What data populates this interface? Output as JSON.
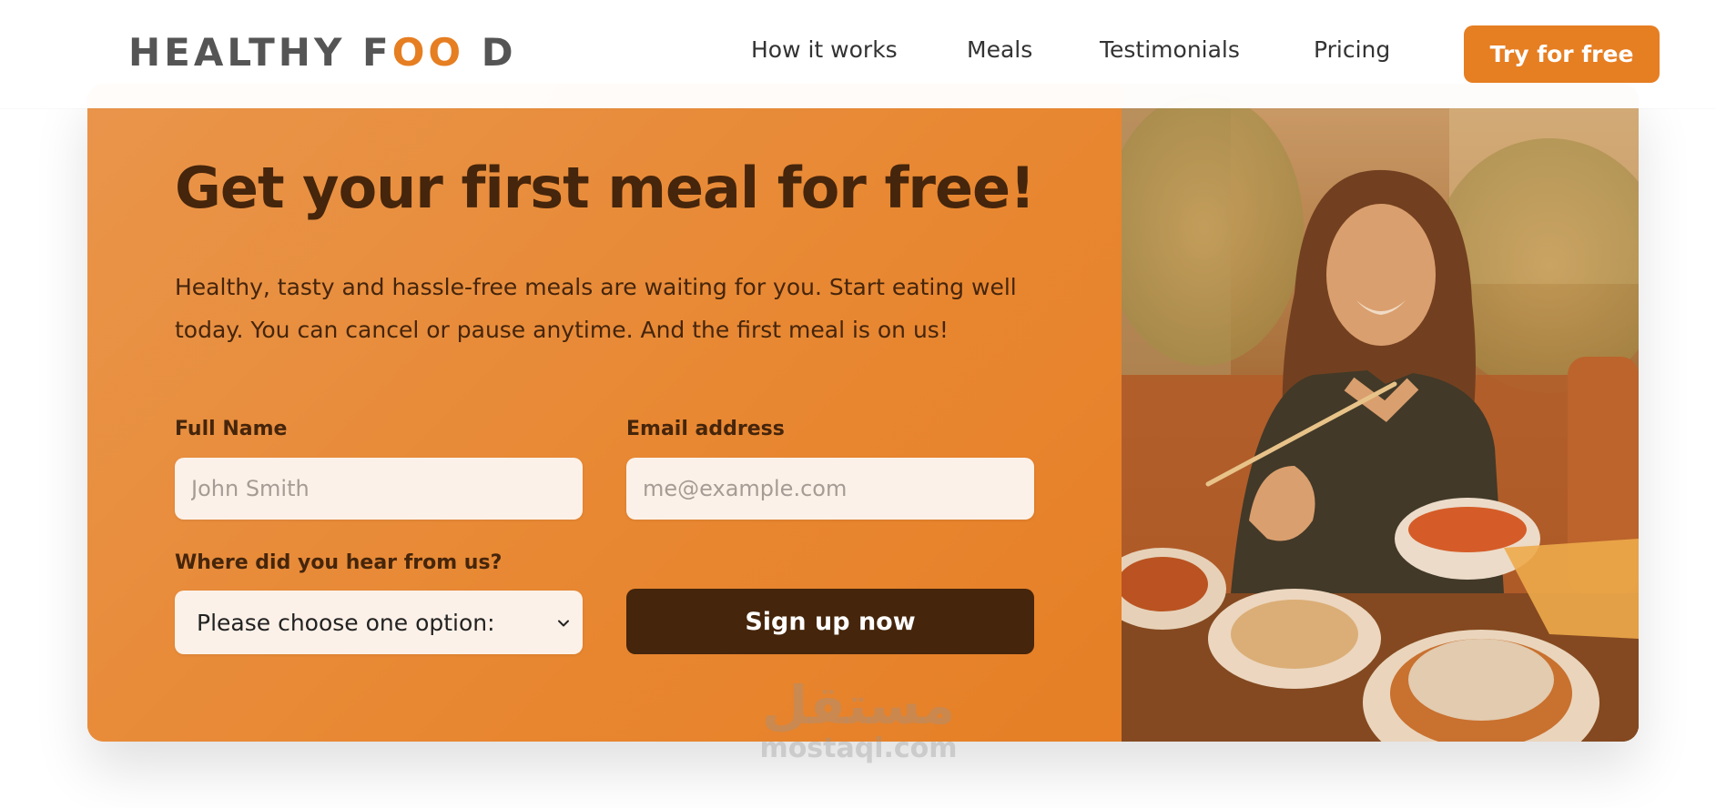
{
  "header": {
    "logo": {
      "part1": "HEALTHY F",
      "part2": "OO",
      "part3": " D"
    },
    "nav": [
      "How it works",
      "Meals",
      "Testimonials",
      "Pricing"
    ],
    "cta_label": "Try for free"
  },
  "cta_section": {
    "title": "Get your first meal for free!",
    "description": "Healthy, tasty and hassle-free meals are waiting for you. Start eating well today. You can cancel or pause anytime. And the first meal is on us!",
    "form": {
      "full_name": {
        "label": "Full Name",
        "placeholder": "John Smith",
        "value": ""
      },
      "email": {
        "label": "Email address",
        "placeholder": "me@example.com",
        "value": ""
      },
      "source": {
        "label": "Where did you hear from us?",
        "selected": "Please choose one option:"
      },
      "submit_label": "Sign up now"
    },
    "image_alt": "Woman enjoying a healthy meal"
  },
  "watermark": {
    "logo": "مستقل",
    "url": "mostaql.com"
  },
  "colors": {
    "accent": "#e67e22",
    "dark_brown": "#45250b",
    "input_bg": "#fcf1e8",
    "logo_gray": "#555555"
  }
}
